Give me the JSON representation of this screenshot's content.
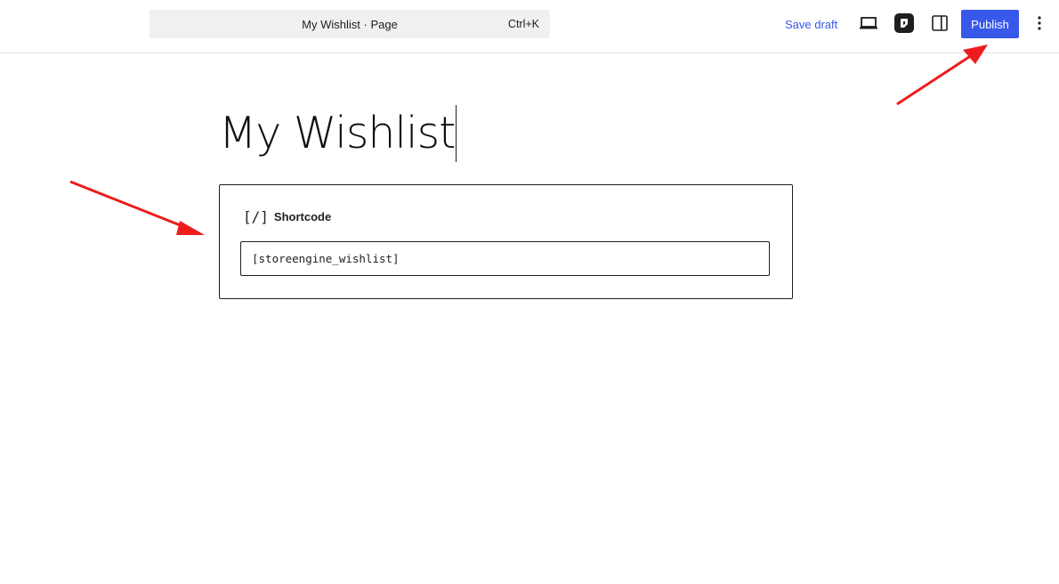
{
  "header": {
    "command_bar_title": "My Wishlist · Page",
    "command_bar_shortcut": "Ctrl+K",
    "save_draft_label": "Save draft",
    "publish_label": "Publish"
  },
  "icons": {
    "preview": "laptop-icon",
    "plugin": "plugin-logo-icon",
    "settings": "sidebar-toggle-icon",
    "options": "vertical-ellipsis-icon"
  },
  "editor": {
    "post_title": "My Wishlist",
    "block": {
      "icon_text": "[/]",
      "label": "Shortcode",
      "value": "[storeengine_wishlist]"
    }
  },
  "colors": {
    "accent": "#3858e9",
    "annotation_arrow": "#ee1c1c"
  }
}
